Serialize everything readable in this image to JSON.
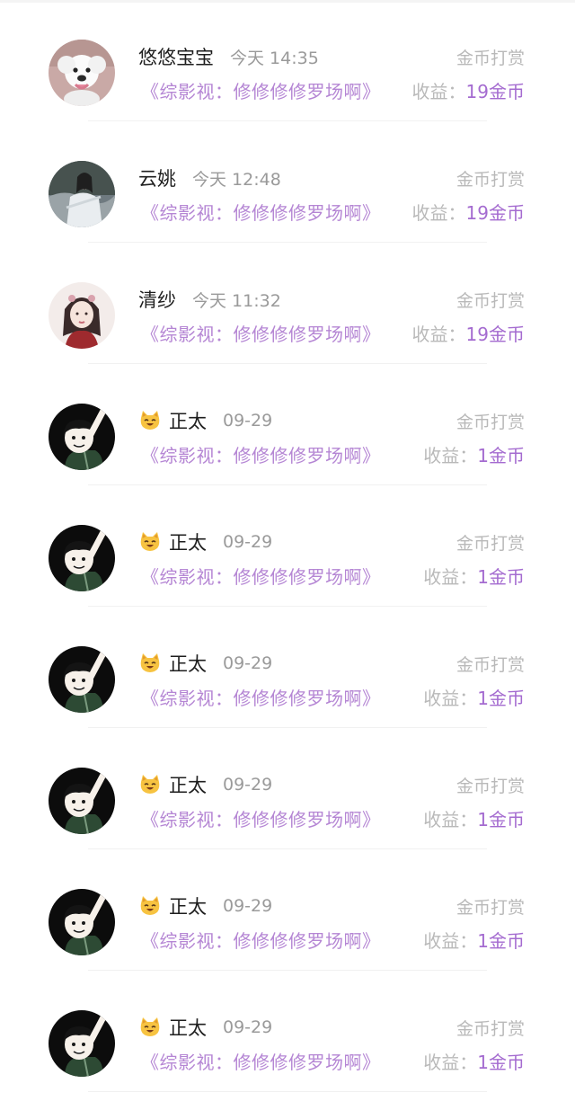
{
  "rows": [
    {
      "name": "悠悠宝宝",
      "time": "今天 14:35",
      "type": "金币打赏",
      "book": "《综影视：修修修修罗场啊》",
      "income_label": "收益：",
      "income_value": "19金币",
      "avatar": "dog-avatar",
      "emoji": null
    },
    {
      "name": "云姚",
      "time": "今天 12:48",
      "type": "金币打赏",
      "book": "《综影视：修修修修罗场啊》",
      "income_label": "收益：",
      "income_value": "19金币",
      "avatar": "swordsman-avatar",
      "emoji": null
    },
    {
      "name": "清纱",
      "time": "今天 11:32",
      "type": "金币打赏",
      "book": "《综影视：修修修修罗场啊》",
      "income_label": "收益：",
      "income_value": "19金币",
      "avatar": "ancient-lady-avatar",
      "emoji": null
    },
    {
      "name": "正太",
      "time": "09-29",
      "type": "金币打赏",
      "book": "《综影视：修修修修罗场啊》",
      "income_label": "收益：",
      "income_value": "1金币",
      "avatar": "cartoon-boy-avatar",
      "emoji": "cat-emoji"
    },
    {
      "name": "正太",
      "time": "09-29",
      "type": "金币打赏",
      "book": "《综影视：修修修修罗场啊》",
      "income_label": "收益：",
      "income_value": "1金币",
      "avatar": "cartoon-boy-avatar",
      "emoji": "cat-emoji"
    },
    {
      "name": "正太",
      "time": "09-29",
      "type": "金币打赏",
      "book": "《综影视：修修修修罗场啊》",
      "income_label": "收益：",
      "income_value": "1金币",
      "avatar": "cartoon-boy-avatar",
      "emoji": "cat-emoji"
    },
    {
      "name": "正太",
      "time": "09-29",
      "type": "金币打赏",
      "book": "《综影视：修修修修罗场啊》",
      "income_label": "收益：",
      "income_value": "1金币",
      "avatar": "cartoon-boy-avatar",
      "emoji": "cat-emoji"
    },
    {
      "name": "正太",
      "time": "09-29",
      "type": "金币打赏",
      "book": "《综影视：修修修修罗场啊》",
      "income_label": "收益：",
      "income_value": "1金币",
      "avatar": "cartoon-boy-avatar",
      "emoji": "cat-emoji"
    },
    {
      "name": "正太",
      "time": "09-29",
      "type": "金币打赏",
      "book": "《综影视：修修修修罗场啊》",
      "income_label": "收益：",
      "income_value": "1金币",
      "avatar": "cartoon-boy-avatar",
      "emoji": "cat-emoji"
    }
  ],
  "colors": {
    "book_title": "#b586d4",
    "income_value": "#a46bd0",
    "muted": "#b9b9b9",
    "name": "#1e1e1e"
  }
}
